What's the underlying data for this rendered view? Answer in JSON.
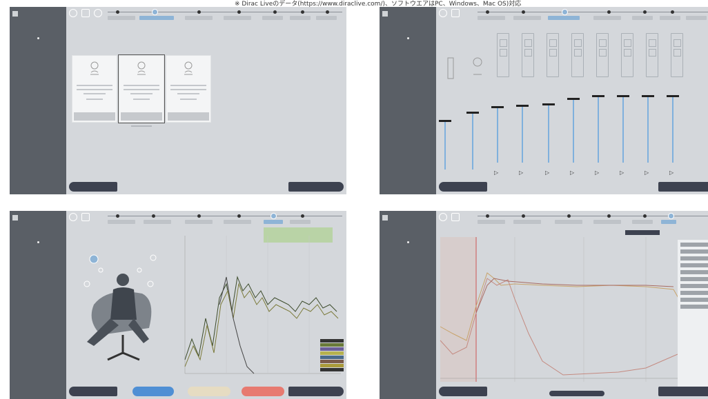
{
  "caption": "※ Dirac Liveのデータ(https://www.diraclive.com/)、ソフトウエアはPC、Windows、Mac OS)対応",
  "colors": {
    "sidebar": "#5a5f66",
    "content_bg": "#d4d7db",
    "accent": "#8eb4d6",
    "nav_button": "#3d4250"
  },
  "icons": [
    "back-icon",
    "grid-icon",
    "refresh-icon",
    "speaker-icon",
    "microphone-icon",
    "play-icon"
  ]
}
